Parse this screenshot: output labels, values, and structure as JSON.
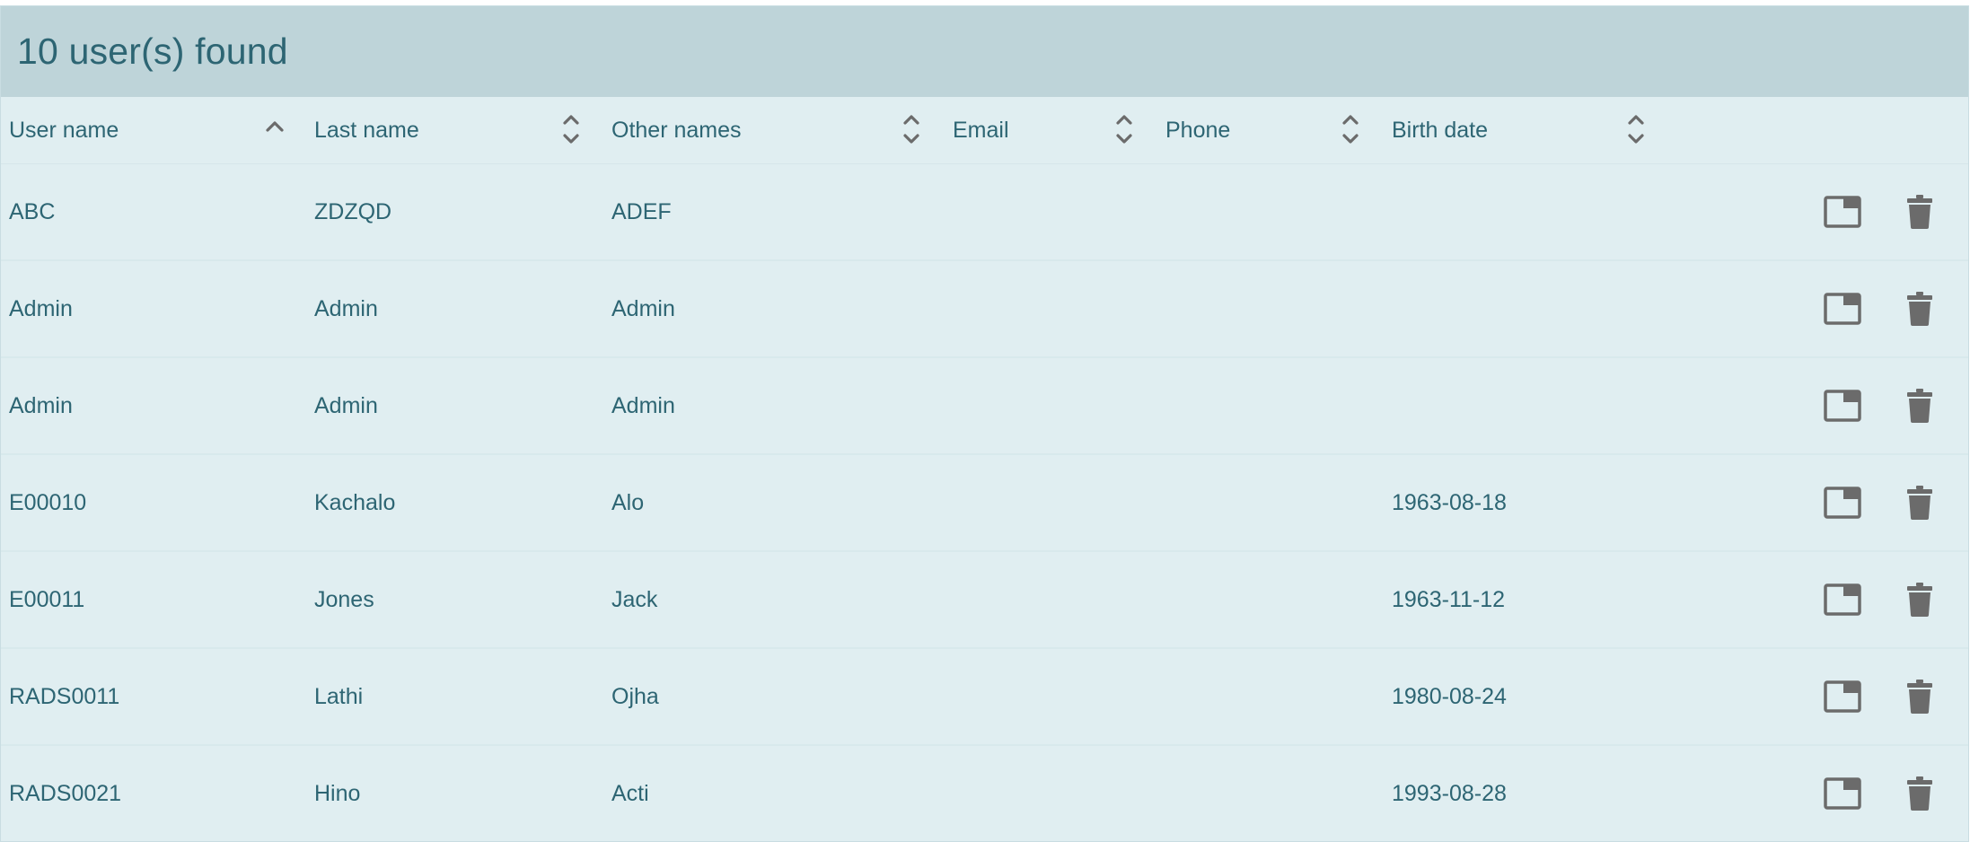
{
  "panel": {
    "title": "10 user(s) found"
  },
  "table": {
    "columns": [
      {
        "key": "username",
        "label": "User name",
        "sort": "asc"
      },
      {
        "key": "lastname",
        "label": "Last name",
        "sort": "none"
      },
      {
        "key": "othernames",
        "label": "Other names",
        "sort": "none"
      },
      {
        "key": "email",
        "label": "Email",
        "sort": "none"
      },
      {
        "key": "phone",
        "label": "Phone",
        "sort": "none"
      },
      {
        "key": "birthdate",
        "label": "Birth date",
        "sort": "none"
      }
    ],
    "rows": [
      {
        "username": "ABC",
        "lastname": "ZDZQD",
        "othernames": "ADEF",
        "email": "",
        "phone": "",
        "birthdate": ""
      },
      {
        "username": "Admin",
        "lastname": "Admin",
        "othernames": "Admin",
        "email": "",
        "phone": "",
        "birthdate": ""
      },
      {
        "username": "Admin",
        "lastname": "Admin",
        "othernames": "Admin",
        "email": "",
        "phone": "",
        "birthdate": ""
      },
      {
        "username": "E00010",
        "lastname": "Kachalo",
        "othernames": "Alo",
        "email": "",
        "phone": "",
        "birthdate": "1963-08-18"
      },
      {
        "username": "E00011",
        "lastname": "Jones",
        "othernames": "Jack",
        "email": "",
        "phone": "",
        "birthdate": "1963-11-12"
      },
      {
        "username": "RADS0011",
        "lastname": "Lathi",
        "othernames": "Ojha",
        "email": "",
        "phone": "",
        "birthdate": "1980-08-24"
      },
      {
        "username": "RADS0021",
        "lastname": "Hino",
        "othernames": "Acti",
        "email": "",
        "phone": "",
        "birthdate": "1993-08-28"
      }
    ],
    "row_actions": [
      "open-in-window-icon",
      "trash-icon"
    ]
  },
  "colors": {
    "header_bg": "#bed4d9",
    "panel_bg": "#e0eef1",
    "text": "#2d6573",
    "icon": "#6b6b6b"
  }
}
